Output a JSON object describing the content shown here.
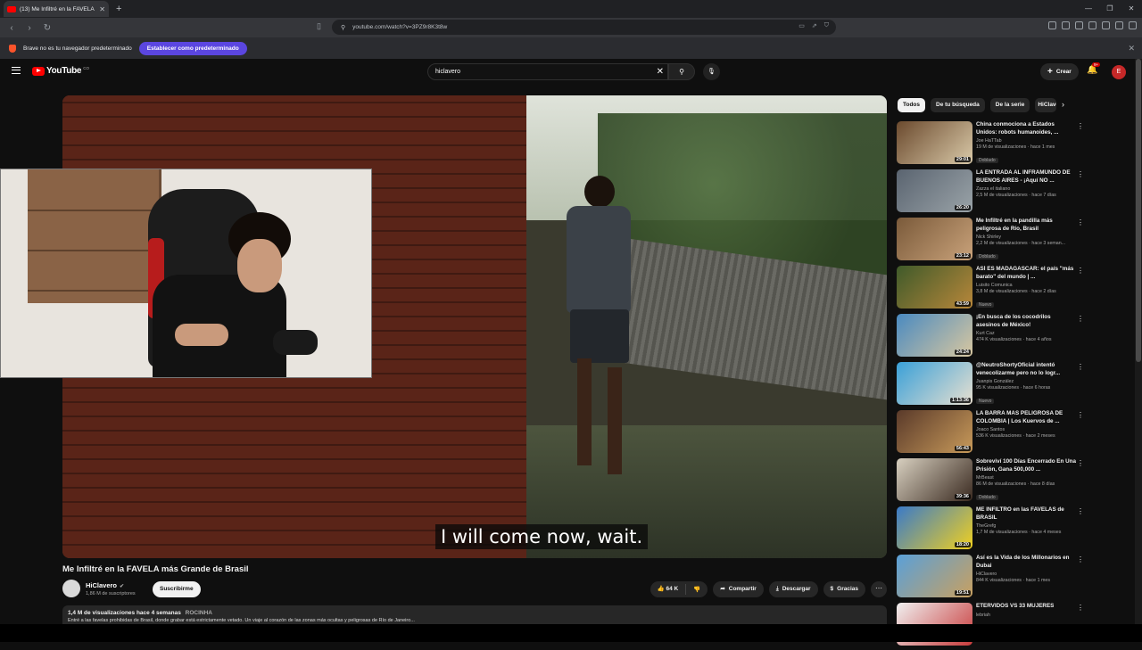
{
  "browser": {
    "tab_title": "(13) Me Infiltré en la FAVELA ...",
    "url": "youtube.com/watch?v=3PZ9r8K3t8w",
    "infobar_text": "Brave no es tu navegador predeterminado",
    "infobar_button": "Establecer como predeterminado"
  },
  "masthead": {
    "logo_text": "YouTube",
    "logo_country": "CO",
    "search_value": "hiclavero",
    "create_label": "Crear",
    "notif_count": "9+",
    "avatar_letter": "E"
  },
  "player": {
    "subtitle": "I will come now, wait."
  },
  "video": {
    "title": "Me Infiltré en la FAVELA más Grande de Brasil",
    "channel": "HiClavero",
    "subscribers": "1,86 M de suscriptores",
    "subscribe_label": "Suscribirme",
    "likes": "64 K",
    "share_label": "Compartir",
    "download_label": "Descargar",
    "thanks_label": "Gracias",
    "views_date": "1,4 M de visualizaciones  hace 4 semanas",
    "tag": "ROCINHA",
    "description_snippet": "Entré a las favelas prohibidas de Brasil, donde grabar está estrictamente vetado. Un viaje al corazón de las zonas más ocultas y peligrosas de Río de Janeiro..."
  },
  "chips": [
    "Todos",
    "De tu búsqueda",
    "De la serie",
    "HiClavero"
  ],
  "recommendations": [
    {
      "title": "China conmociona a Estados Unidos: robots humanoides, ...",
      "channel": "Joe HaTTab",
      "meta": "19 M de visualizaciones · hace 1 mes",
      "badge": "Doblado",
      "duration": "29:01",
      "colors": [
        "#6b4a2e",
        "#d9c9a8"
      ]
    },
    {
      "title": "LA ENTRADA AL INFRAMUNDO DE BUENOS AIRES - ¡Aquí NO ...",
      "channel": "Zazza el italiano",
      "meta": "2,5 M de visualizaciones · hace 7 días",
      "badge": "",
      "duration": "26:20",
      "colors": [
        "#5a6470",
        "#9aa3a8"
      ]
    },
    {
      "title": "Me Infiltré en la pandilla más peligrosa de Río, Brasil",
      "channel": "Nick Shirley",
      "meta": "2,2 M de visualizaciones · hace 3 seman...",
      "badge": "Doblado",
      "duration": "23:12",
      "colors": [
        "#7a5a3a",
        "#c9a27a"
      ]
    },
    {
      "title": "ASÍ ES MADAGASCAR: el país \"más barato\" del mundo | ...",
      "channel": "Luisito Comunica",
      "meta": "3,8 M de visualizaciones · hace 2 días",
      "badge": "Nuevo",
      "duration": "43:59",
      "colors": [
        "#3f5a2a",
        "#b8873a"
      ]
    },
    {
      "title": "¡En busca de los cocodrilos asesinos de México!",
      "channel": "Kurt Caz",
      "meta": "474 K visualizaciones · hace 4 años",
      "badge": "",
      "duration": "24:24",
      "colors": [
        "#4a8ac0",
        "#d8c7a0"
      ]
    },
    {
      "title": "@NeutroShortyOficial intentó venecolizarme pero no lo logr...",
      "channel": "Juanpis González",
      "meta": "95 K visualizaciones · hace 6 horas",
      "badge": "Nuevo",
      "duration": "1:13:36",
      "colors": [
        "#3aa0d8",
        "#e8e0d0"
      ]
    },
    {
      "title": "LA BARRA MAS PELIGROSA DE COLOMBIA | Los Kuervos de ...",
      "channel": "Joaco Santos",
      "meta": "536 K visualizaciones · hace 2 meses",
      "badge": "",
      "duration": "56:43",
      "colors": [
        "#5a3a2a",
        "#c89a5a"
      ]
    },
    {
      "title": "Sobreviví 100 Días Encerrado En Una Prisión, Gana 500,000 ...",
      "channel": "MrBeast",
      "meta": "86 M de visualizaciones · hace 8 días",
      "badge": "Doblado",
      "duration": "39:36",
      "colors": [
        "#d8d0c0",
        "#3a2a20"
      ]
    },
    {
      "title": "ME INFILTRO en las FAVELAS de BRASIL",
      "channel": "TheGrefg",
      "meta": "1,7 M de visualizaciones · hace 4 meses",
      "badge": "",
      "duration": "18:20",
      "colors": [
        "#3a7ac8",
        "#f0d020"
      ]
    },
    {
      "title": "Así es la Vida de los Millonarios en Dubai",
      "channel": "HiClavero",
      "meta": "844 K visualizaciones · hace 1 mes",
      "badge": "",
      "duration": "19:51",
      "colors": [
        "#5aa0d8",
        "#c8a060"
      ]
    },
    {
      "title": "ETERVIDOS VS 33 MUJERES",
      "channel": "lebriah",
      "meta": "",
      "badge": "",
      "duration": "",
      "colors": [
        "#f0f0f0",
        "#c83a3a"
      ]
    }
  ],
  "colors": {
    "accent": "#ff0000",
    "brave_purple": "#5b46e0"
  }
}
